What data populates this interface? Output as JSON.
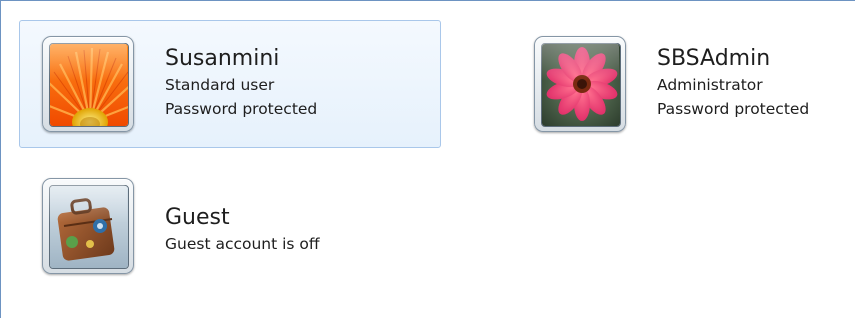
{
  "accounts": [
    {
      "name": "Susanmini",
      "type": "Standard user",
      "status": "Password protected",
      "picture": "orange-gerbera-flower",
      "selected": true
    },
    {
      "name": "SBSAdmin",
      "type": "Administrator",
      "status": "Password protected",
      "picture": "pink-daisy-flower",
      "selected": false
    },
    {
      "name": "Guest",
      "type": "Guest account is off",
      "picture": "suitcase",
      "selected": false
    }
  ],
  "colors": {
    "pane_border": "#6d93c2",
    "selection_border": "#a9c7ea",
    "selection_fill": "#e6f1fc",
    "text": "#1e1e1e"
  }
}
